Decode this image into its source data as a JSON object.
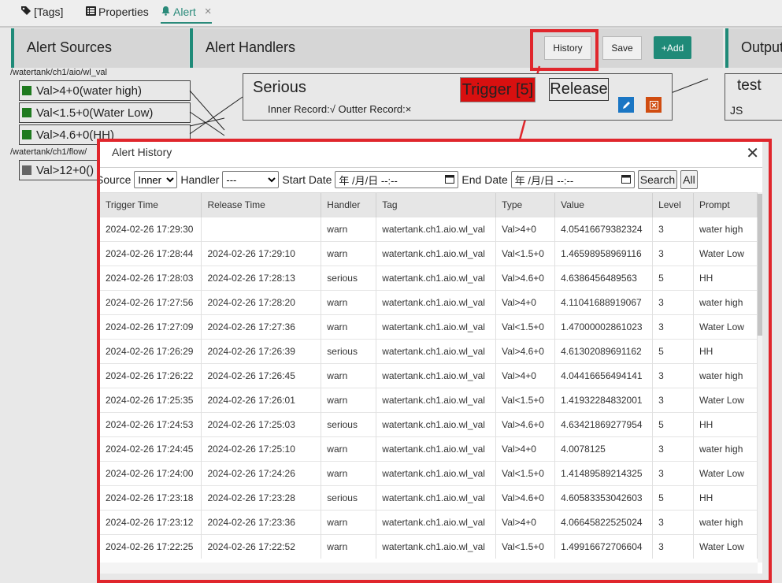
{
  "tabs": [
    {
      "icon": "tags-icon",
      "label": "[Tags]"
    },
    {
      "icon": "list-icon",
      "label": "Properties"
    },
    {
      "icon": "bell-icon",
      "label": "Alert",
      "active": true
    }
  ],
  "columns": {
    "sources_title": "Alert Sources",
    "handlers_title": "Alert Handlers",
    "outputs_title": "Output"
  },
  "toolbar": {
    "history": "History",
    "save": "Save",
    "add": "+Add"
  },
  "sources": {
    "group1_path": "/watertank/ch1/aio/wl_val",
    "group1_items": [
      "Val>4+0(water high)",
      "Val<1.5+0(Water Low)",
      "Val>4.6+0(HH)"
    ],
    "group2_path": "/watertank/ch1/flow/",
    "group2_items": [
      "Val>12+0()"
    ]
  },
  "handler": {
    "name": "Serious",
    "record": "Inner Record:√ Outter Record:×",
    "trigger": "Trigger [5]",
    "release": "Release"
  },
  "output": {
    "name": "test",
    "type": "JS"
  },
  "dialog": {
    "title": "Alert History",
    "source_label": "Source",
    "source_value": "Inner",
    "handler_label": "Handler",
    "handler_value": "---",
    "start_label": "Start Date",
    "end_label": "End Date",
    "date_placeholder": "年 /月/日 --:--",
    "search": "Search",
    "all": "All"
  },
  "table": {
    "headers": [
      "Trigger Time",
      "Release Time",
      "Handler",
      "Tag",
      "Type",
      "Value",
      "Level",
      "Prompt"
    ],
    "rows": [
      [
        "2024-02-26 17:29:30",
        "",
        "warn",
        "watertank.ch1.aio.wl_val",
        "Val>4+0",
        "4.05416679382324",
        "3",
        "water high"
      ],
      [
        "2024-02-26 17:28:44",
        "2024-02-26 17:29:10",
        "warn",
        "watertank.ch1.aio.wl_val",
        "Val<1.5+0",
        "1.46598958969116",
        "3",
        "Water Low"
      ],
      [
        "2024-02-26 17:28:03",
        "2024-02-26 17:28:13",
        "serious",
        "watertank.ch1.aio.wl_val",
        "Val>4.6+0",
        "4.6386456489563",
        "5",
        "HH"
      ],
      [
        "2024-02-26 17:27:56",
        "2024-02-26 17:28:20",
        "warn",
        "watertank.ch1.aio.wl_val",
        "Val>4+0",
        "4.11041688919067",
        "3",
        "water high"
      ],
      [
        "2024-02-26 17:27:09",
        "2024-02-26 17:27:36",
        "warn",
        "watertank.ch1.aio.wl_val",
        "Val<1.5+0",
        "1.47000002861023",
        "3",
        "Water Low"
      ],
      [
        "2024-02-26 17:26:29",
        "2024-02-26 17:26:39",
        "serious",
        "watertank.ch1.aio.wl_val",
        "Val>4.6+0",
        "4.61302089691162",
        "5",
        "HH"
      ],
      [
        "2024-02-26 17:26:22",
        "2024-02-26 17:26:45",
        "warn",
        "watertank.ch1.aio.wl_val",
        "Val>4+0",
        "4.04416656494141",
        "3",
        "water high"
      ],
      [
        "2024-02-26 17:25:35",
        "2024-02-26 17:26:01",
        "warn",
        "watertank.ch1.aio.wl_val",
        "Val<1.5+0",
        "1.41932284832001",
        "3",
        "Water Low"
      ],
      [
        "2024-02-26 17:24:53",
        "2024-02-26 17:25:03",
        "serious",
        "watertank.ch1.aio.wl_val",
        "Val>4.6+0",
        "4.63421869277954",
        "5",
        "HH"
      ],
      [
        "2024-02-26 17:24:45",
        "2024-02-26 17:25:10",
        "warn",
        "watertank.ch1.aio.wl_val",
        "Val>4+0",
        "4.0078125",
        "3",
        "water high"
      ],
      [
        "2024-02-26 17:24:00",
        "2024-02-26 17:24:26",
        "warn",
        "watertank.ch1.aio.wl_val",
        "Val<1.5+0",
        "1.41489589214325",
        "3",
        "Water Low"
      ],
      [
        "2024-02-26 17:23:18",
        "2024-02-26 17:23:28",
        "serious",
        "watertank.ch1.aio.wl_val",
        "Val>4.6+0",
        "4.60583353042603",
        "5",
        "HH"
      ],
      [
        "2024-02-26 17:23:12",
        "2024-02-26 17:23:36",
        "warn",
        "watertank.ch1.aio.wl_val",
        "Val>4+0",
        "4.06645822525024",
        "3",
        "water high"
      ],
      [
        "2024-02-26 17:22:25",
        "2024-02-26 17:22:52",
        "warn",
        "watertank.ch1.aio.wl_val",
        "Val<1.5+0",
        "1.49916672706604",
        "3",
        "Water Low"
      ]
    ]
  },
  "colors": {
    "accent": "#1f8a78",
    "highlight": "#e0262c",
    "trigger": "#d81010"
  }
}
